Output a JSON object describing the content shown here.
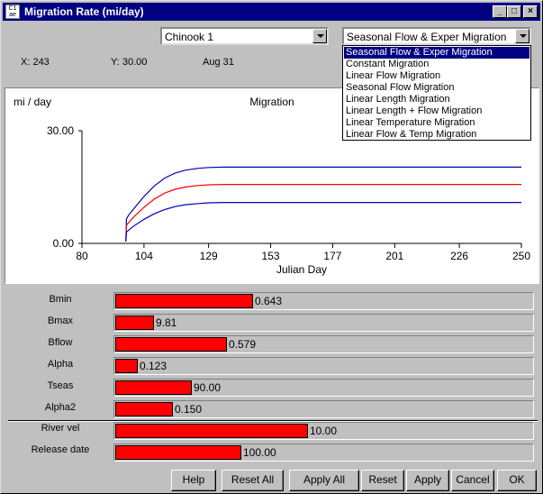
{
  "window": {
    "title": "Migration Rate (mi/day)",
    "icon_text": "C1 ae",
    "minimize_icon": "minimize-icon",
    "maximize_icon": "maximize-icon",
    "close_icon": "close-icon"
  },
  "stock_select": {
    "value": "Chinook 1"
  },
  "model_select": {
    "value": "Seasonal Flow & Exper Migration",
    "options": [
      "Seasonal Flow & Exper Migration",
      "Constant Migration",
      "Linear Flow Migration",
      "Seasonal Flow Migration",
      "Linear Length Migration",
      "Linear Length + Flow Migration",
      "Linear Temperature Migration",
      "Linear Flow & Temp Migration"
    ],
    "selected_index": 0
  },
  "readout": {
    "x": "X: 243",
    "y": "Y: 30.00",
    "date": "Aug 31"
  },
  "chart_data": {
    "type": "line",
    "title": "Migration",
    "ylabel": "mi / day",
    "xlabel": "Julian Day",
    "xlim": [
      80,
      250
    ],
    "ylim": [
      0,
      30
    ],
    "yticks": [
      "0.00",
      "30.00"
    ],
    "xticks": [
      "80",
      "104",
      "129",
      "153",
      "177",
      "201",
      "226",
      "250"
    ],
    "grid": false,
    "series": [
      {
        "color": "#0000c0",
        "x": [
          97,
          97.2,
          98,
          100,
          104,
          108,
          112,
          116,
          120,
          125,
          129,
          135,
          140,
          153,
          177,
          201,
          226,
          250
        ],
        "y": [
          0.5,
          6.5,
          7.5,
          9.2,
          12.5,
          15.3,
          17.4,
          18.7,
          19.5,
          20.0,
          20.2,
          20.3,
          20.3,
          20.3,
          20.3,
          20.3,
          20.3,
          20.3
        ]
      },
      {
        "color": "#ff0000",
        "x": [
          97,
          97.2,
          98,
          100,
          104,
          108,
          112,
          116,
          120,
          125,
          129,
          135,
          140,
          153,
          177,
          201,
          226,
          250
        ],
        "y": [
          0.5,
          4.8,
          5.5,
          7.0,
          9.6,
          11.8,
          13.4,
          14.4,
          15.0,
          15.4,
          15.6,
          15.7,
          15.7,
          15.7,
          15.7,
          15.7,
          15.7,
          15.7
        ]
      },
      {
        "color": "#0000c0",
        "x": [
          97,
          97.2,
          98,
          100,
          104,
          108,
          112,
          116,
          120,
          125,
          129,
          135,
          140,
          153,
          177,
          201,
          226,
          250
        ],
        "y": [
          0.5,
          3.0,
          3.5,
          4.6,
          6.4,
          7.9,
          9.0,
          9.8,
          10.3,
          10.6,
          10.8,
          10.9,
          10.9,
          10.9,
          10.9,
          10.9,
          10.9,
          10.9
        ]
      }
    ]
  },
  "params": [
    {
      "label": "Bmin",
      "value": "0.643",
      "fill": 0.33
    },
    {
      "label": "Bmax",
      "value": "9.81",
      "fill": 0.092
    },
    {
      "label": "Bflow",
      "value": "0.579",
      "fill": 0.267
    },
    {
      "label": "Alpha",
      "value": "0.123",
      "fill": 0.055
    },
    {
      "label": "Tseas",
      "value": "90.00",
      "fill": 0.183
    },
    {
      "label": "Alpha2",
      "value": "0.150",
      "fill": 0.138
    },
    {
      "label": "River vel",
      "value": "10.00",
      "fill": 0.462
    },
    {
      "label": "Release date",
      "value": "100.00",
      "fill": 0.302
    }
  ],
  "buttons": {
    "help": "Help",
    "reset_all": "Reset All",
    "apply_all": "Apply All",
    "reset": "Reset",
    "apply": "Apply",
    "cancel": "Cancel",
    "ok": "OK"
  }
}
